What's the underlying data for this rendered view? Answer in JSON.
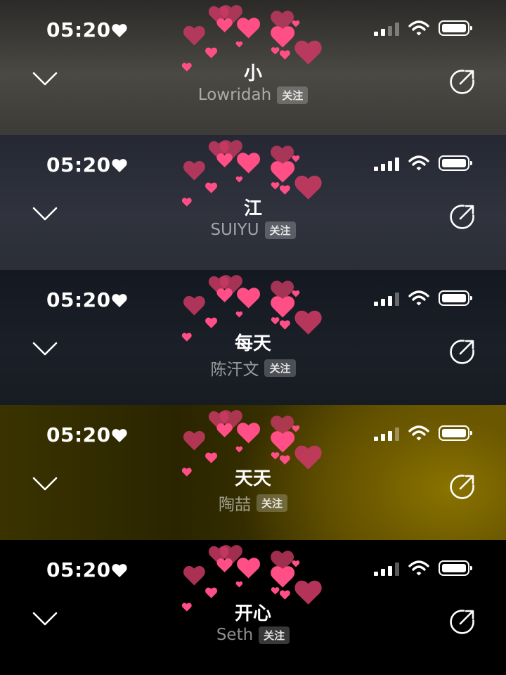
{
  "panels": [
    {
      "time": "05:20",
      "title": "小",
      "artist": "Lowridah",
      "follow_label": "关注",
      "signal_bars": 2
    },
    {
      "time": "05:20",
      "title": "江",
      "artist": "SUIYU",
      "follow_label": "关注",
      "signal_bars": 4
    },
    {
      "time": "05:20",
      "title": "每天",
      "artist": "陈汗文",
      "follow_label": "关注",
      "signal_bars": 3
    },
    {
      "time": "05:20",
      "title": "天天",
      "artist": "陶喆",
      "follow_label": "关注",
      "signal_bars": 3
    },
    {
      "time": "05:20",
      "title": "开心",
      "artist": "Seth",
      "follow_label": "关注",
      "signal_bars": 3
    }
  ],
  "icons": {
    "collapse": "chevron-down-icon",
    "share": "share-icon",
    "status_heart": "heart-icon",
    "decoration": "hearts-sticker"
  },
  "colors": {
    "heart_pink": "#ff4f86",
    "heart_dark": "#c83a63",
    "text_white": "#ffffff"
  }
}
